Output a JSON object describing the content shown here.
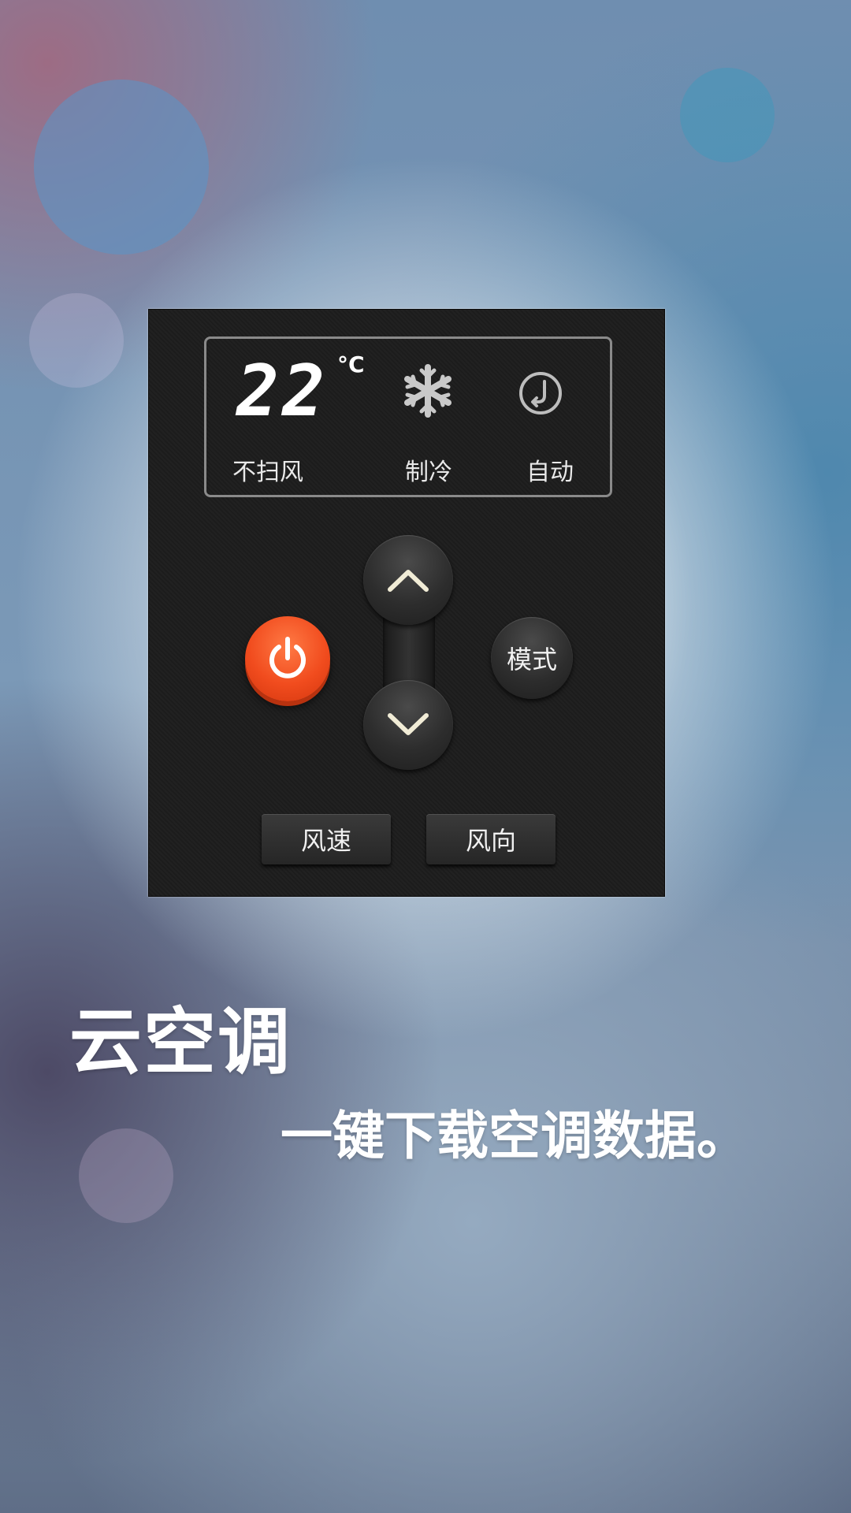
{
  "remote": {
    "display": {
      "temperature": "22",
      "unit": "°C",
      "swing_label": "不扫风",
      "mode_label": "制冷",
      "fan_label": "自动"
    },
    "mode_button_label": "模式",
    "fan_speed_button_label": "风速",
    "fan_direction_button_label": "风向"
  },
  "promo": {
    "title": "云空调",
    "subtitle": "一键下载空调数据。"
  },
  "colors": {
    "power_button": "#f14c1e",
    "remote_body": "#1d1d1d",
    "display_border": "#8a8a8a"
  },
  "icons": [
    "power-icon",
    "snowflake-icon",
    "auto-fan-icon",
    "chevron-up-icon",
    "chevron-down-icon"
  ]
}
